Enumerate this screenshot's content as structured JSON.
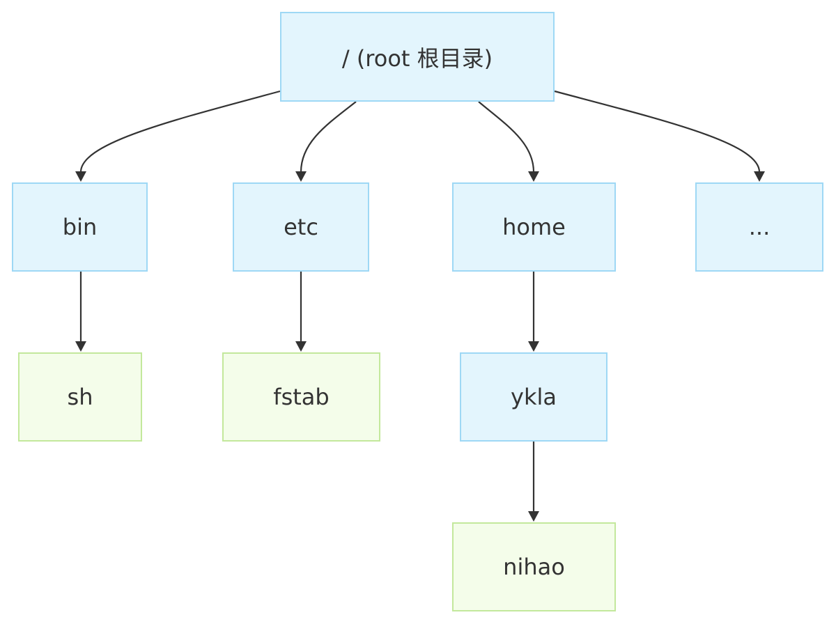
{
  "diagram": {
    "type": "directory-tree",
    "colors": {
      "directory_fill": "#e3f5fd",
      "directory_border": "#9ed8f5",
      "file_fill": "#f4fdea",
      "file_border": "#c3e89c",
      "edge": "#333333",
      "text": "#333333"
    },
    "nodes": {
      "root": {
        "label": "/ (root 根目录)",
        "kind": "directory"
      },
      "bin": {
        "label": "bin",
        "kind": "directory"
      },
      "etc": {
        "label": "etc",
        "kind": "directory"
      },
      "home": {
        "label": "home",
        "kind": "directory"
      },
      "more": {
        "label": "...",
        "kind": "directory"
      },
      "sh": {
        "label": "sh",
        "kind": "file"
      },
      "fstab": {
        "label": "fstab",
        "kind": "file"
      },
      "ykla": {
        "label": "ykla",
        "kind": "directory"
      },
      "nihao": {
        "label": "nihao",
        "kind": "file"
      }
    },
    "edges": [
      {
        "from": "root",
        "to": "bin"
      },
      {
        "from": "root",
        "to": "etc"
      },
      {
        "from": "root",
        "to": "home"
      },
      {
        "from": "root",
        "to": "more"
      },
      {
        "from": "bin",
        "to": "sh"
      },
      {
        "from": "etc",
        "to": "fstab"
      },
      {
        "from": "home",
        "to": "ykla"
      },
      {
        "from": "ykla",
        "to": "nihao"
      }
    ]
  }
}
